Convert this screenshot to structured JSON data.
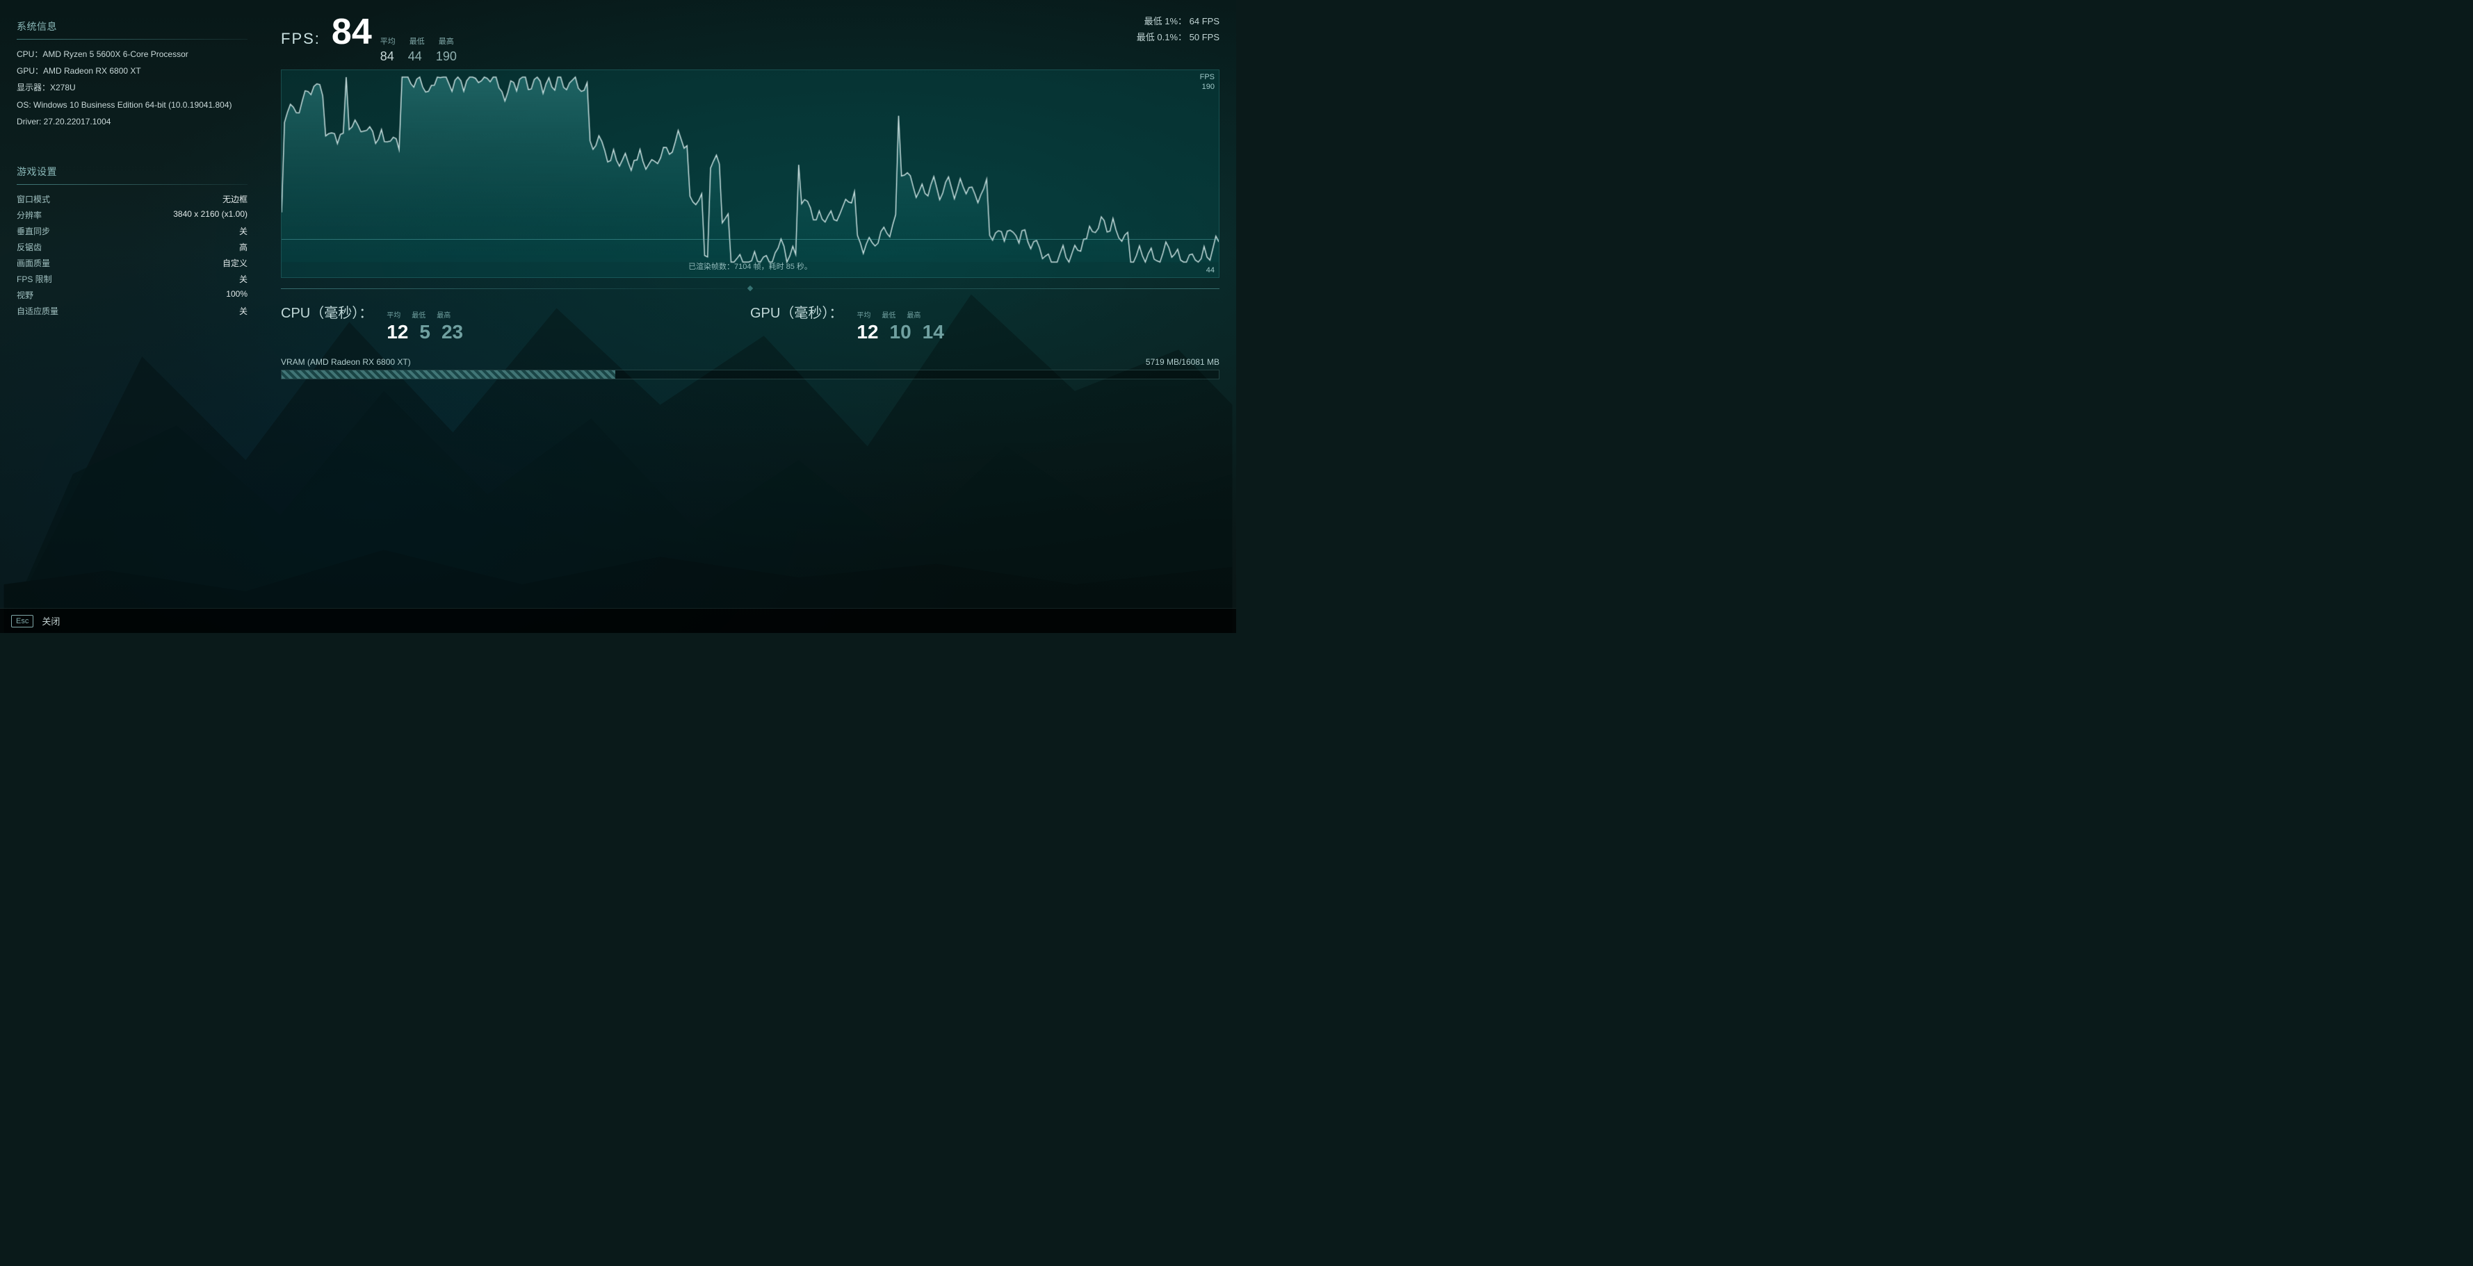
{
  "background": {
    "color": "#0a1a1a"
  },
  "system_info": {
    "section_title": "系统信息",
    "cpu": "CPU：AMD Ryzen 5 5600X 6-Core Processor",
    "gpu": "GPU：AMD Radeon RX 6800 XT",
    "display": "显示器：X278U",
    "os": "OS: Windows 10 Business Edition 64-bit (10.0.19041.804)",
    "driver": "Driver: 27.20.22017.1004"
  },
  "game_settings": {
    "section_title": "游戏设置",
    "rows": [
      {
        "key": "窗口模式",
        "value": "无边框"
      },
      {
        "key": "分辨率",
        "value": "3840 x 2160 (x1.00)"
      },
      {
        "key": "垂直同步",
        "value": "关"
      },
      {
        "key": "反锯齿",
        "value": "高"
      },
      {
        "key": "画面质量",
        "value": "自定义"
      },
      {
        "key": "FPS 限制",
        "value": "关"
      },
      {
        "key": "视野",
        "value": "100%"
      },
      {
        "key": "自适应质量",
        "value": "关"
      }
    ]
  },
  "fps": {
    "label": "FPS:",
    "stats_header": {
      "avg": "平均",
      "min": "最低",
      "max": "最高"
    },
    "avg": "84",
    "min": "44",
    "max": "190",
    "low1_label": "最低 1%：",
    "low1_value": "64 FPS",
    "low01_label": "最低 0.1%：",
    "low01_value": "50 FPS",
    "graph_label": "FPS",
    "graph_top": "190",
    "graph_bottom": "44",
    "rendered_info": "已渲染帧数：7104 帧，耗时 85 秒。"
  },
  "cpu_metric": {
    "label": "CPU（毫秒）：",
    "stats_header": {
      "avg": "平均",
      "min": "最低",
      "max": "最高"
    },
    "avg": "12",
    "min": "5",
    "max": "23"
  },
  "gpu_metric": {
    "label": "GPU（毫秒）：",
    "stats_header": {
      "avg": "平均",
      "min": "最低",
      "max": "最高"
    },
    "avg": "12",
    "min": "10",
    "max": "14"
  },
  "vram": {
    "label": "VRAM (AMD Radeon RX 6800 XT)",
    "used": "5719 MB/16081 MB",
    "fill_pct": 35.6
  },
  "footer": {
    "esc_key": "Esc",
    "close_label": "关闭"
  }
}
